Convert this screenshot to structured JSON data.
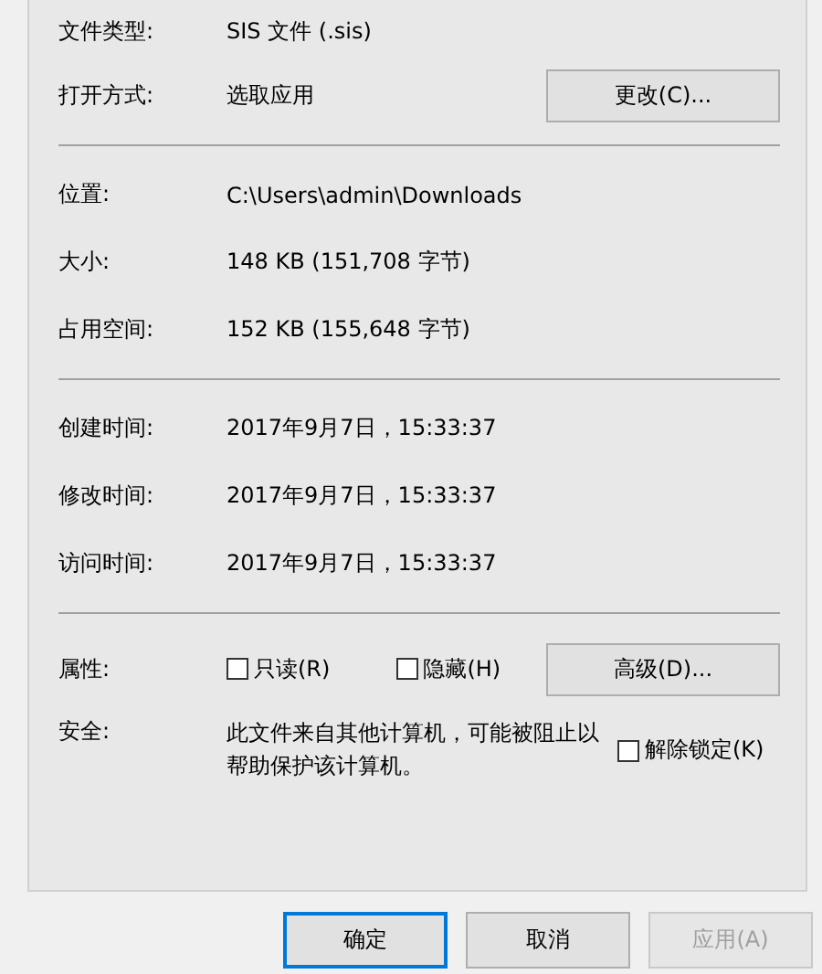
{
  "general": {
    "type_label": "文件类型:",
    "type_value": "SIS 文件 (.sis)",
    "opens_label": "打开方式:",
    "opens_value": "选取应用",
    "change_button": "更改(C)..."
  },
  "location_rows": [
    {
      "label": "位置:",
      "value": "C:\\Users\\admin\\Downloads"
    },
    {
      "label": "大小:",
      "value": "148 KB (151,708 字节)"
    },
    {
      "label": "占用空间:",
      "value": "152 KB (155,648 字节)"
    }
  ],
  "time_rows": [
    {
      "label": "创建时间:",
      "value": "2017年9月7日，15:33:37"
    },
    {
      "label": "修改时间:",
      "value": "2017年9月7日，15:33:37"
    },
    {
      "label": "访问时间:",
      "value": "2017年9月7日，15:33:37"
    }
  ],
  "attributes": {
    "label": "属性:",
    "checkboxes": [
      {
        "label": "只读(R)",
        "checked": false
      },
      {
        "label": "隐藏(H)",
        "checked": false
      }
    ],
    "advanced_button": "高级(D)..."
  },
  "security": {
    "label": "安全:",
    "text": "此文件来自其他计算机，可能被阻止以帮助保护该计算机。",
    "unblock": {
      "label": "解除锁定(K)",
      "checked": false
    }
  },
  "buttons": [
    {
      "label": "确定",
      "default": true,
      "disabled": false
    },
    {
      "label": "取消",
      "default": false,
      "disabled": false
    },
    {
      "label": "应用(A)",
      "default": false,
      "disabled": true
    }
  ]
}
